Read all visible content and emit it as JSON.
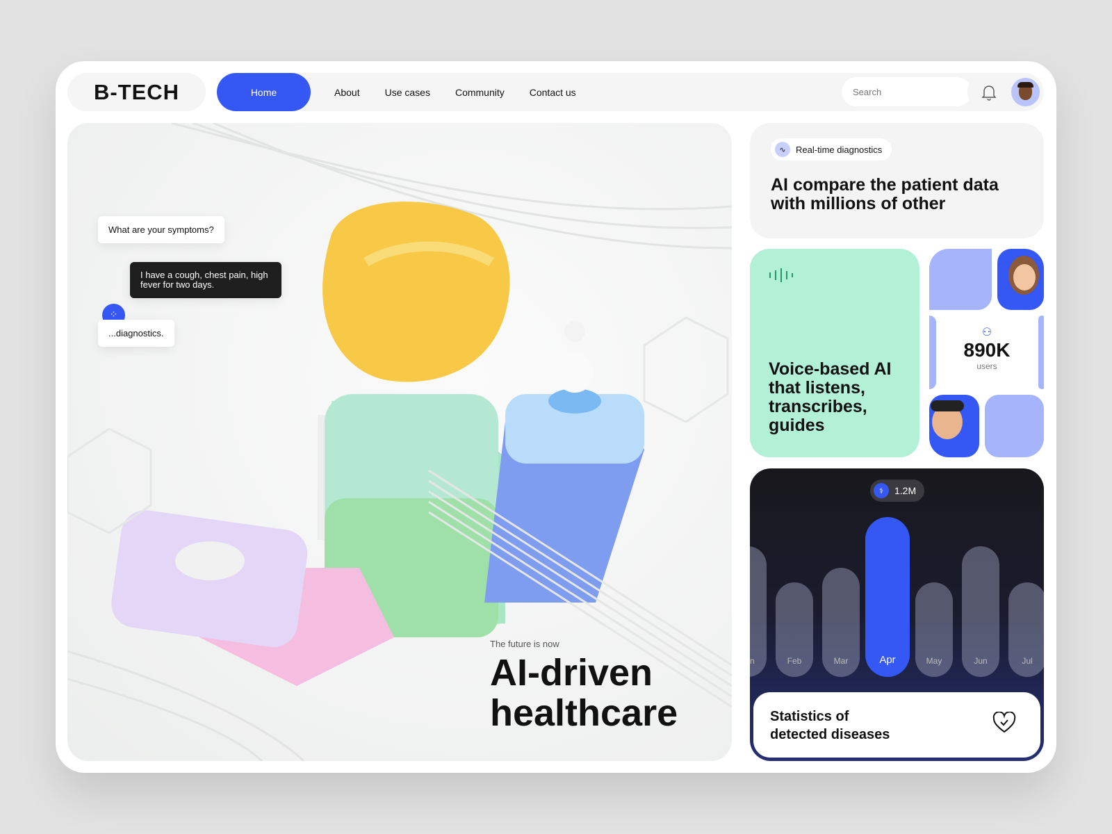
{
  "nav": {
    "logo": "B-TECH",
    "items": [
      "Home",
      "About",
      "Use cases",
      "Community",
      "Contact us"
    ],
    "search_placeholder": "Search"
  },
  "hero": {
    "chat": [
      "What are your symptoms?",
      "I have a cough, chest pain, high fever for two days.",
      "...diagnostics."
    ],
    "eyebrow": "The future is now",
    "title_line1": "AI-driven",
    "title_line2": "healthcare"
  },
  "diagnostics": {
    "badge": "Real-time diagnostics",
    "title": "AI compare the patient data with millions of other"
  },
  "voice": {
    "title": "Voice-based AI that listens, transcribes, guides"
  },
  "users": {
    "value": "890K",
    "label": "users"
  },
  "stats": {
    "title_line1": "Statistics of",
    "title_line2": "detected diseases",
    "accent": "#3558f5"
  },
  "chart_data": {
    "type": "bar",
    "categories": [
      "Jan",
      "Feb",
      "Mar",
      "Apr",
      "May",
      "Jun",
      "Jul"
    ],
    "values": [
      0.98,
      0.71,
      0.82,
      1.2,
      0.71,
      0.98,
      0.71
    ],
    "unit": "M",
    "highlight": "Apr",
    "highlight_label": "1.2M"
  }
}
